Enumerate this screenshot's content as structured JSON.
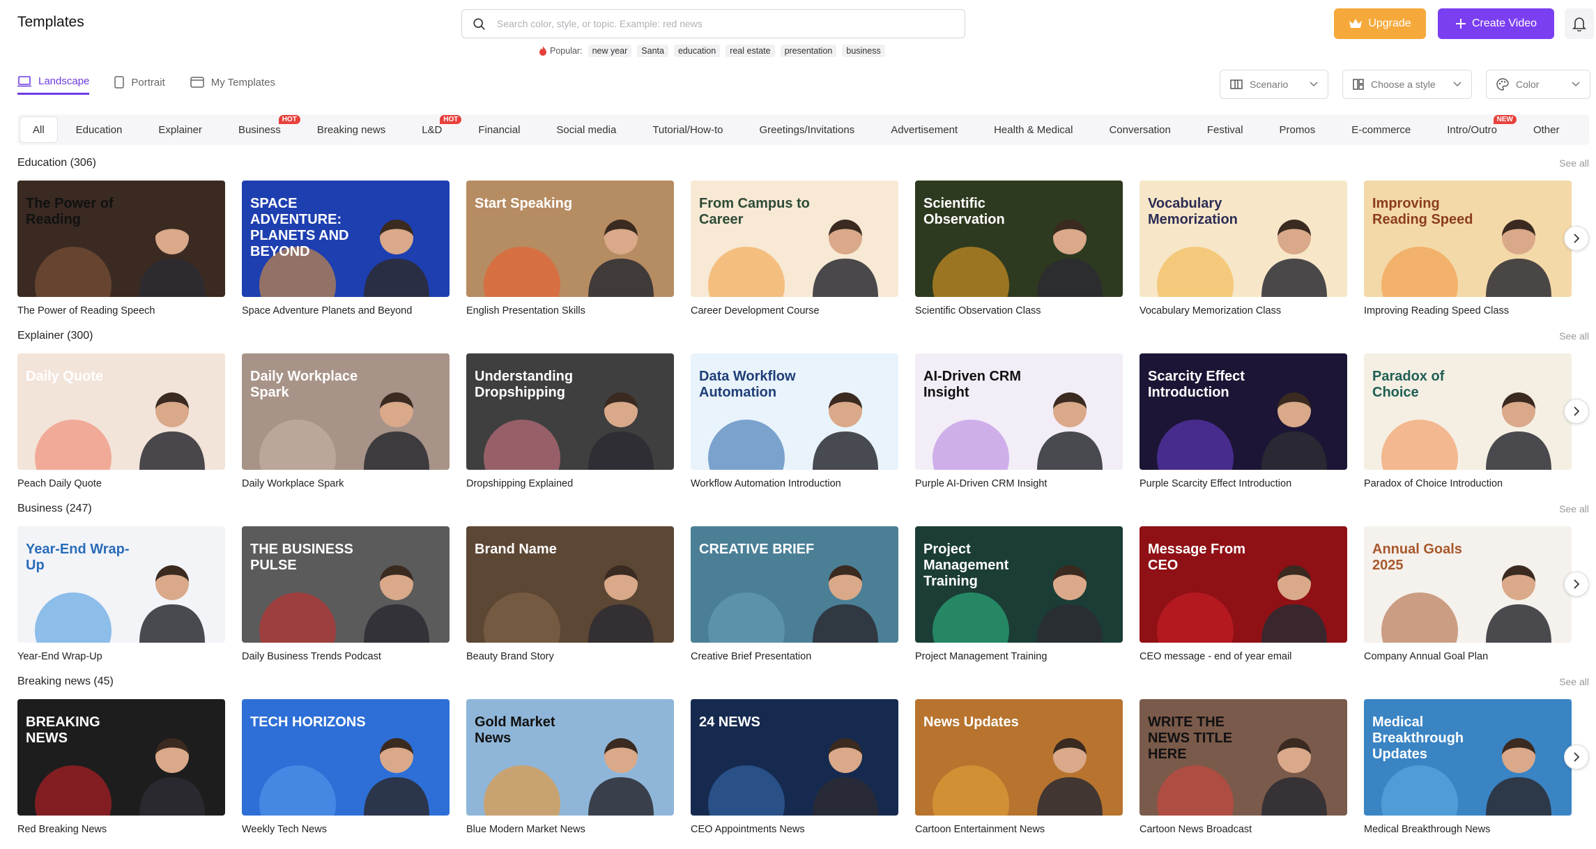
{
  "header": {
    "title": "Templates",
    "search_placeholder": "Search color, style, or topic. Example: red news",
    "popular_label": "Popular:",
    "popular_tags": [
      "new year",
      "Santa",
      "education",
      "real estate",
      "presentation",
      "business"
    ],
    "upgrade_label": "Upgrade",
    "create_label": "Create Video"
  },
  "view_tabs": [
    {
      "label": "Landscape",
      "active": true
    },
    {
      "label": "Portrait",
      "active": false
    },
    {
      "label": "My Templates",
      "active": false
    }
  ],
  "filters": {
    "scenario": "Scenario",
    "style": "Choose a style",
    "color": "Color"
  },
  "categories": [
    {
      "label": "All",
      "active": true,
      "badge": ""
    },
    {
      "label": "Education",
      "badge": ""
    },
    {
      "label": "Explainer",
      "badge": ""
    },
    {
      "label": "Business",
      "badge": "HOT"
    },
    {
      "label": "Breaking news",
      "badge": ""
    },
    {
      "label": "L&D",
      "badge": "HOT"
    },
    {
      "label": "Financial",
      "badge": ""
    },
    {
      "label": "Social media",
      "badge": ""
    },
    {
      "label": "Tutorial/How-to",
      "badge": ""
    },
    {
      "label": "Greetings/Invitations",
      "badge": ""
    },
    {
      "label": "Advertisement",
      "badge": ""
    },
    {
      "label": "Health & Medical",
      "badge": ""
    },
    {
      "label": "Conversation",
      "badge": ""
    },
    {
      "label": "Festival",
      "badge": ""
    },
    {
      "label": "Promos",
      "badge": ""
    },
    {
      "label": "E-commerce",
      "badge": ""
    },
    {
      "label": "Intro/Outro",
      "badge": "NEW"
    },
    {
      "label": "Other",
      "badge": ""
    }
  ],
  "see_all_label": "See all",
  "sections": [
    {
      "title": "Education (306)",
      "cards": [
        {
          "name": "The Power of Reading Speech",
          "bg": "#3a2a22",
          "accent": "#8b5a3c",
          "text": "The Power of Reading",
          "tcolor": "#111"
        },
        {
          "name": "Space Adventure Planets and Beyond",
          "bg": "#1d3fb0",
          "accent": "#f59b2a",
          "text": "SPACE ADVENTURE: PLANETS AND BEYOND",
          "tcolor": "#fff"
        },
        {
          "name": "English Presentation Skills",
          "bg": "#b68c62",
          "accent": "#f05a28",
          "text": "Start Speaking",
          "tcolor": "#fff"
        },
        {
          "name": "Career Development Course",
          "bg": "#f7e9d4",
          "accent": "#f29b38",
          "text": "From Campus to Career",
          "tcolor": "#2e4a37"
        },
        {
          "name": "Scientific Observation Class",
          "bg": "#2e3a1f",
          "accent": "#f5a623",
          "text": "Scientific Observation",
          "tcolor": "#fff"
        },
        {
          "name": "Vocabulary Memorization Class",
          "bg": "#f7e7c8",
          "accent": "#f3b13d",
          "text": "Vocabulary Memorization",
          "tcolor": "#2c2c54"
        },
        {
          "name": "Improving Reading Speed Class",
          "bg": "#f4d9a8",
          "accent": "#f1923b",
          "text": "Improving Reading Speed",
          "tcolor": "#8b3d1f"
        }
      ]
    },
    {
      "title": "Explainer (300)",
      "cards": [
        {
          "name": "Peach Daily Quote",
          "bg": "#f3e4da",
          "accent": "#f07a63",
          "text": "Daily Quote",
          "tcolor": "#fff"
        },
        {
          "name": "Daily Workplace Spark",
          "bg": "#a89388",
          "accent": "#c9b6ab",
          "text": "Daily Workplace Spark",
          "tcolor": "#fff"
        },
        {
          "name": "Dropshipping Explained",
          "bg": "#3f3f3f",
          "accent": "#e07a8b",
          "text": "Understanding Dropshipping",
          "tcolor": "#fff"
        },
        {
          "name": "Workflow Automation Introduction",
          "bg": "#e9f3fb",
          "accent": "#1f5fa8",
          "text": "Data Workflow Automation",
          "tcolor": "#1f3f78"
        },
        {
          "name": "Purple AI-Driven CRM Insight",
          "bg": "#f2edf7",
          "accent": "#b27be0",
          "text": "AI-Driven CRM Insight",
          "tcolor": "#111"
        },
        {
          "name": "Purple Scarcity Effect Introduction",
          "bg": "#1c1535",
          "accent": "#6c3fd6",
          "text": "Scarcity Effect Introduction",
          "tcolor": "#fff"
        },
        {
          "name": "Paradox of Choice Introduction",
          "bg": "#f5efe3",
          "accent": "#f08a4b",
          "text": "Paradox of Choice",
          "tcolor": "#1f5f55"
        }
      ]
    },
    {
      "title": "Business (247)",
      "cards": [
        {
          "name": "Year-End Wrap-Up",
          "bg": "#f2f4f8",
          "accent": "#3a8fdc",
          "text": "Year-End Wrap-Up",
          "tcolor": "#2a6cb8"
        },
        {
          "name": "Daily Business Trends Podcast",
          "bg": "#5b5b5b",
          "accent": "#d62828",
          "text": "THE BUSINESS PULSE",
          "tcolor": "#fff"
        },
        {
          "name": "Beauty Brand Story",
          "bg": "#5c4634",
          "accent": "#8b6b4f",
          "text": "Brand Name",
          "tcolor": "#fff"
        },
        {
          "name": "Creative Brief Presentation",
          "bg": "#4a7f96",
          "accent": "#6ea4ba",
          "text": "CREATIVE BRIEF",
          "tcolor": "#fff"
        },
        {
          "name": "Project Management Training",
          "bg": "#1b3d35",
          "accent": "#2dc48a",
          "text": "Project Management Training",
          "tcolor": "#fff"
        },
        {
          "name": "CEO message - end of year email",
          "bg": "#8f1015",
          "accent": "#d4202a",
          "text": "Message From CEO",
          "tcolor": "#fff"
        },
        {
          "name": "Company Annual Goal Plan",
          "bg": "#f5f1ec",
          "accent": "#a85a2e",
          "text": "Annual Goals 2025",
          "tcolor": "#a8582c"
        }
      ]
    },
    {
      "title": "Breaking news (45)",
      "cards": [
        {
          "name": "Red Breaking News",
          "bg": "#1d1d1d",
          "accent": "#d51f26",
          "text": "BREAKING NEWS",
          "tcolor": "#fff"
        },
        {
          "name": "Weekly Tech News",
          "bg": "#2d6fd6",
          "accent": "#5a9cf0",
          "text": "TECH HORIZONS",
          "tcolor": "#fff"
        },
        {
          "name": "Blue Modern Market News",
          "bg": "#8fb6d8",
          "accent": "#f7931e",
          "text": "Gold Market News",
          "tcolor": "#111"
        },
        {
          "name": "CEO Appointments News",
          "bg": "#162a4f",
          "accent": "#3b6fb6",
          "text": "24 NEWS",
          "tcolor": "#fff"
        },
        {
          "name": "Cartoon Entertainment News",
          "bg": "#b8742f",
          "accent": "#e8a838",
          "text": "News Updates",
          "tcolor": "#fff"
        },
        {
          "name": "Cartoon News Broadcast",
          "bg": "#7a5a4a",
          "accent": "#d8443c",
          "text": "WRITE THE NEWS TITLE HERE",
          "tcolor": "#111"
        },
        {
          "name": "Medical Breakthrough News",
          "bg": "#3a84c4",
          "accent": "#63b0e6",
          "text": "Medical Breakthrough Updates",
          "tcolor": "#fff"
        }
      ]
    }
  ]
}
